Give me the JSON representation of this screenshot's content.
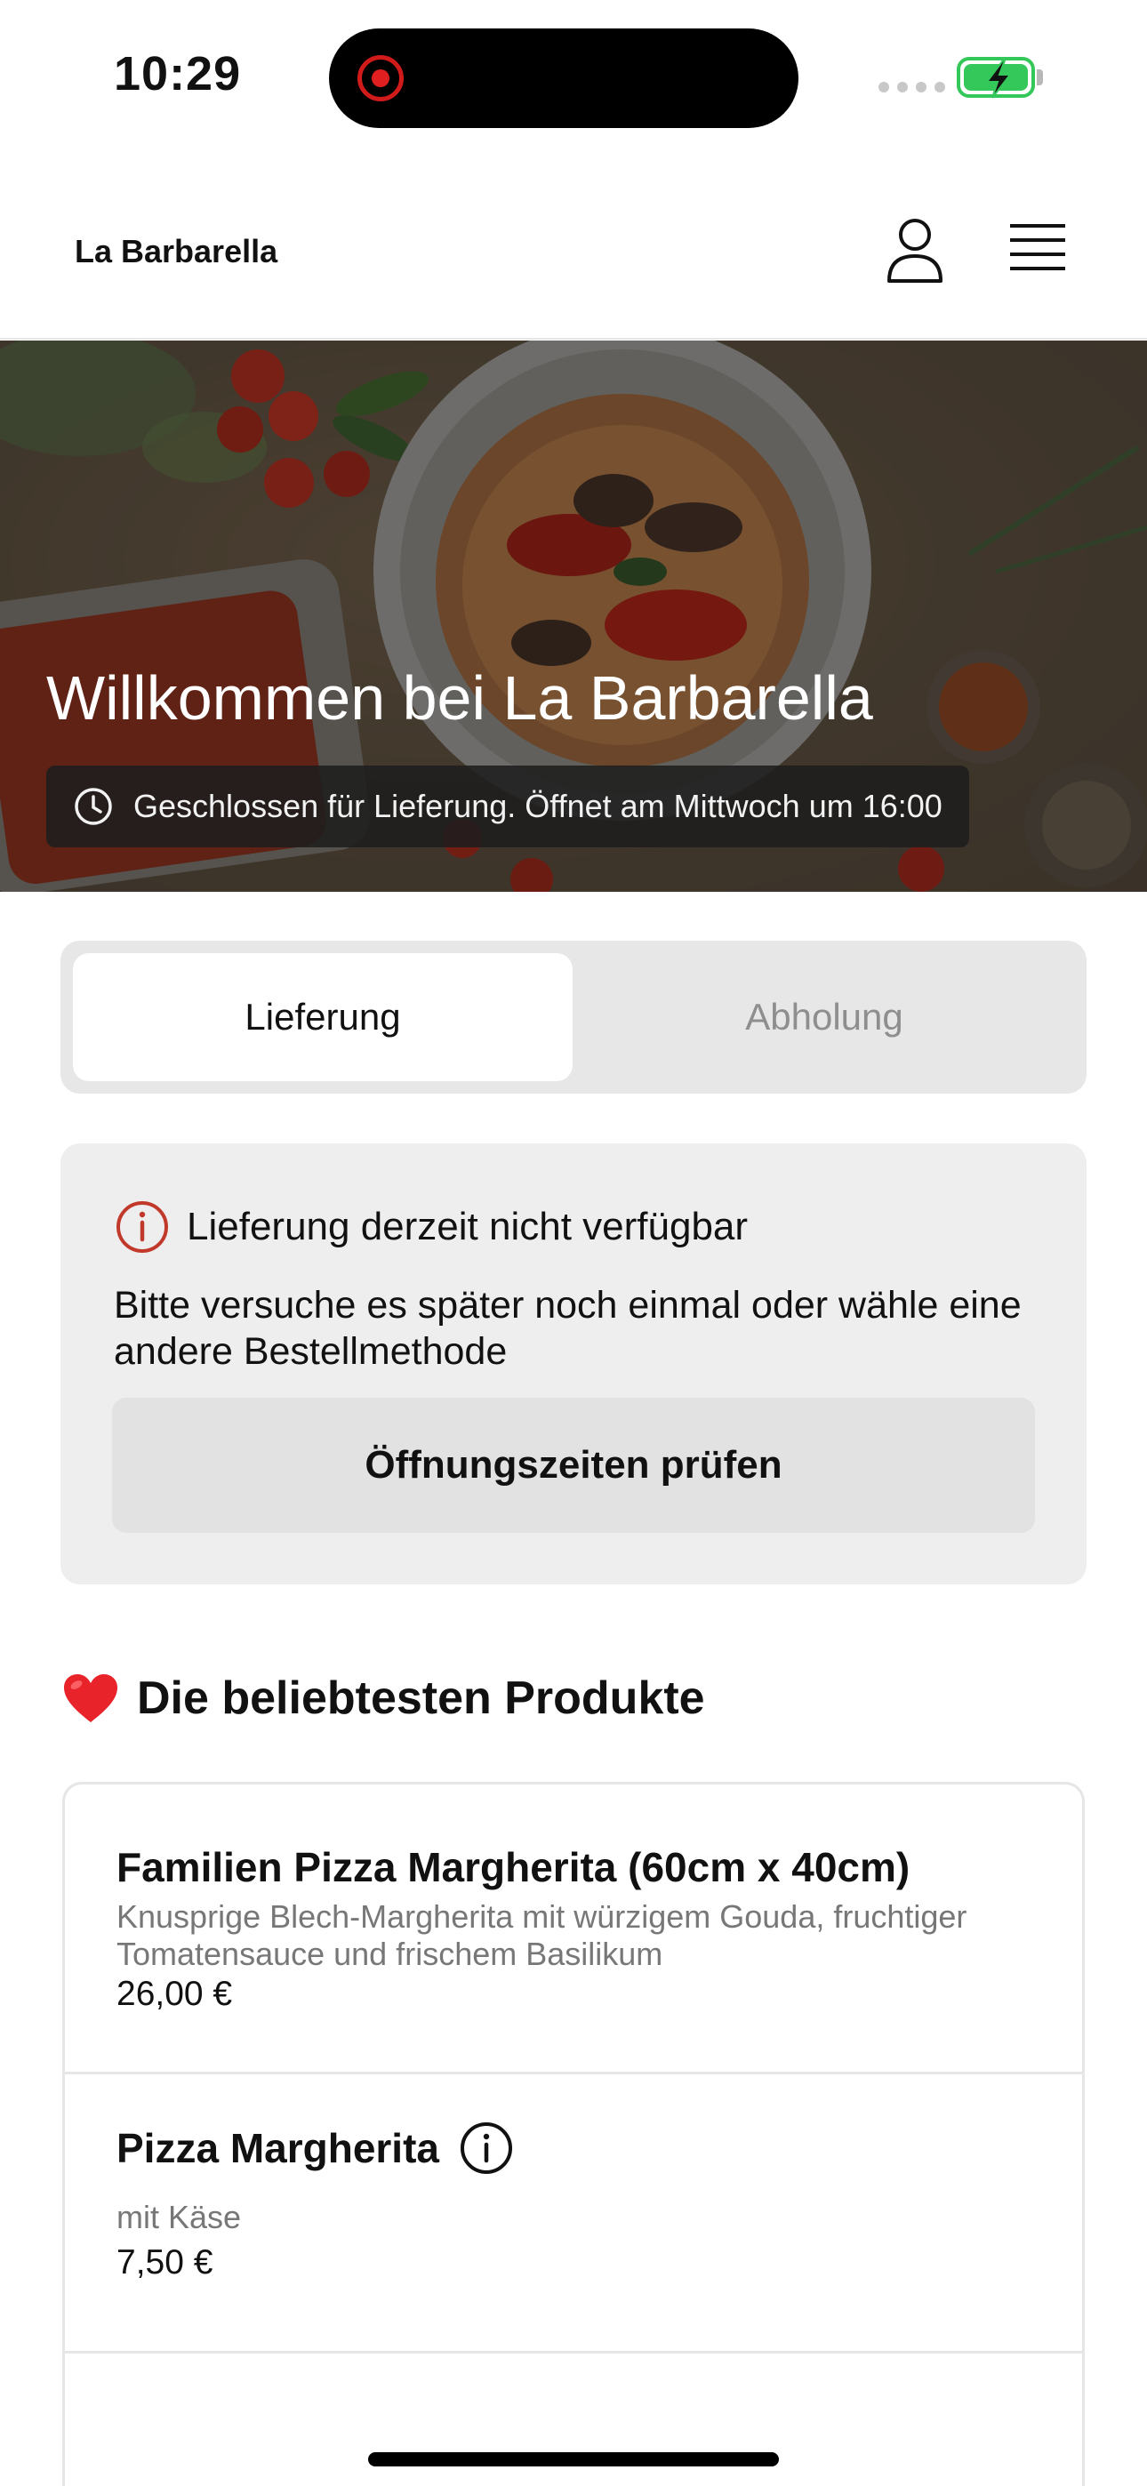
{
  "status_bar": {
    "time": "10:29"
  },
  "header": {
    "brand": "La Barbarella",
    "icons": [
      "user-icon",
      "menu-icon"
    ]
  },
  "hero": {
    "title": "Willkommen bei La Barbarella",
    "status": "Geschlossen für Lieferung. Öffnet am Mittwoch um 16:00"
  },
  "order_mode": {
    "options": [
      "Lieferung",
      "Abholung"
    ],
    "selected": "Lieferung"
  },
  "notice": {
    "title": "Lieferung derzeit nicht verfügbar",
    "text": "Bitte versuche es später noch einmal oder wähle eine andere Bestellmethode",
    "button": "Öffnungszeiten prüfen"
  },
  "popular": {
    "emoji": "❤️",
    "title": "Die beliebtesten Produkte",
    "products": [
      {
        "name": "Familien Pizza Margherita (60cm x 40cm)",
        "description": "Knusprige Blech-Margherita mit würzigem Gouda, fruchtiger Tomatensauce und frischem Basilikum",
        "price": "26,00 €"
      },
      {
        "name": "Pizza Margherita",
        "description": "mit Käse",
        "price": "7,50 €"
      }
    ]
  },
  "colors": {
    "accent_red": "#c0392b",
    "battery_green": "#34c759",
    "card_bg": "#eeeeee"
  }
}
